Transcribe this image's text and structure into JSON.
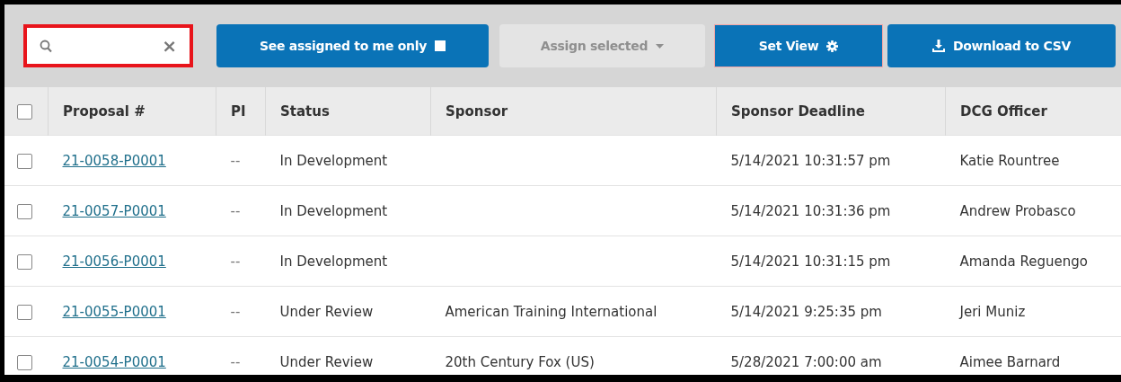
{
  "search": {
    "clear_label": "×"
  },
  "toolbar": {
    "assigned_filter": {
      "label": "See assigned to me only",
      "checked": false
    },
    "assign_selected": {
      "label": "Assign selected",
      "disabled": true
    },
    "set_view": {
      "label": "Set View"
    },
    "download": {
      "label": "Download to CSV"
    }
  },
  "table": {
    "select_all": false,
    "columns": [
      "Proposal #",
      "PI",
      "Status",
      "Sponsor",
      "Sponsor Deadline",
      "DCG Officer"
    ],
    "rows": [
      {
        "selected": false,
        "proposal": "21-0058-P0001",
        "pi": "--",
        "status": "In Development",
        "sponsor": "",
        "deadline": "5/14/2021 10:31:57 pm",
        "officer": "Katie Rountree"
      },
      {
        "selected": false,
        "proposal": "21-0057-P0001",
        "pi": "--",
        "status": "In Development",
        "sponsor": "",
        "deadline": "5/14/2021 10:31:36 pm",
        "officer": "Andrew Probasco"
      },
      {
        "selected": false,
        "proposal": "21-0056-P0001",
        "pi": "--",
        "status": "In Development",
        "sponsor": "",
        "deadline": "5/14/2021 10:31:15 pm",
        "officer": "Amanda Reguengo"
      },
      {
        "selected": false,
        "proposal": "21-0055-P0001",
        "pi": "--",
        "status": "Under Review",
        "sponsor": "American Training International",
        "deadline": "5/14/2021 9:25:35 pm",
        "officer": "Jeri Muniz"
      },
      {
        "selected": false,
        "proposal": "21-0054-P0001",
        "pi": "--",
        "status": "Under Review",
        "sponsor": "20th Century Fox (US)",
        "deadline": "5/28/2021 7:00:00 am",
        "officer": "Aimee Barnard"
      }
    ]
  }
}
